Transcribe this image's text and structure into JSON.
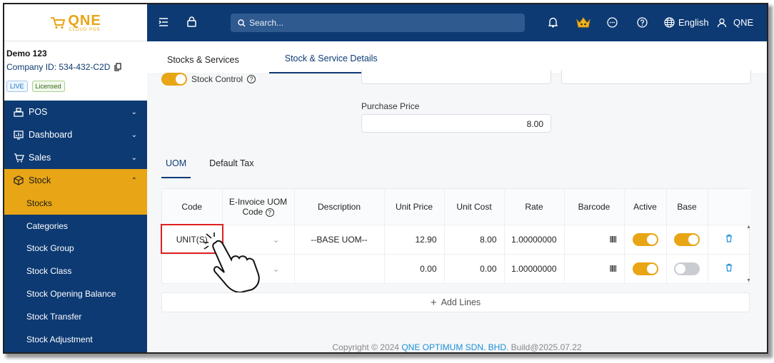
{
  "brand": {
    "logo_main": "QNE",
    "logo_sub": "CLOUD POS"
  },
  "company": {
    "name": "Demo 123",
    "id_label": "Company ID: 534-432-C2D",
    "badge_live": "LIVE",
    "badge_licensed": "Licensed"
  },
  "sidebar": {
    "items": [
      {
        "label": "POS",
        "icon": "register-icon"
      },
      {
        "label": "Dashboard",
        "icon": "chart-icon"
      },
      {
        "label": "Sales",
        "icon": "cart-icon"
      },
      {
        "label": "Stock",
        "icon": "box-icon"
      }
    ],
    "stock_sub": [
      "Stocks",
      "Categories",
      "Stock Group",
      "Stock Class",
      "Stock Opening Balance",
      "Stock Transfer",
      "Stock Adjustment"
    ]
  },
  "topbar": {
    "search_placeholder": "Search...",
    "language": "English",
    "user": "QNE"
  },
  "tabs": [
    "Stocks & Services",
    "Stock & Service Details"
  ],
  "form": {
    "stock_control_label": "Stock Control",
    "purchase_price_label": "Purchase Price",
    "purchase_price_value": "8.00"
  },
  "uom_tabs": [
    "UOM",
    "Default Tax"
  ],
  "uom_table": {
    "headers": [
      "Code",
      "E-Invoice UOM Code",
      "Description",
      "Unit Price",
      "Unit Cost",
      "Rate",
      "Barcode",
      "Active",
      "Base"
    ],
    "rows": [
      {
        "code": "UNIT(S)",
        "einvoice": "",
        "description": "--BASE UOM--",
        "unit_price": "12.90",
        "unit_cost": "8.00",
        "rate": "1.00000000",
        "active": true,
        "base": true
      },
      {
        "code": "",
        "einvoice": "",
        "description": "",
        "unit_price": "0.00",
        "unit_cost": "0.00",
        "rate": "1.00000000",
        "active": true,
        "base": false
      }
    ]
  },
  "add_lines_label": "Add Lines",
  "footer": {
    "copyright_prefix": "Copyright",
    "year": "2024",
    "company_name": "QNE OPTIMUM SDN. BHD.",
    "build": "Build@2025.07.22"
  },
  "colors": {
    "navy": "#0d3a73",
    "accent": "#e8a515",
    "highlight": "#e02020"
  }
}
